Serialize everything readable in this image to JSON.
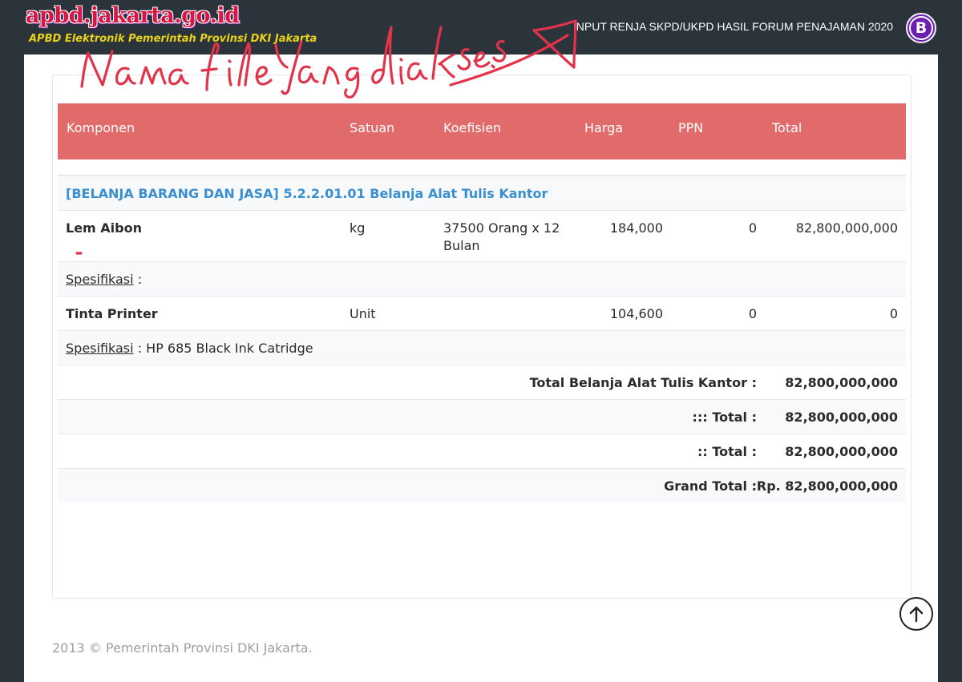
{
  "header": {
    "logo_title": "apbd.jakarta.go.id",
    "logo_subtitle": "APBD Elektronik Pemerintah Provinsi DKI Jakarta",
    "page_title": "INPUT RENJA SKPD/UKPD HASIL FORUM PENAJAMAN 2020",
    "badge_letter": "B"
  },
  "table": {
    "columns": [
      "Komponen",
      "Satuan",
      "Koefisien",
      "Harga",
      "PPN",
      "Total"
    ],
    "group_title": "[BELANJA BARANG DAN JASA] 5.2.2.01.01 Belanja Alat Tulis Kantor",
    "items": [
      {
        "komponen": "Lem Aibon",
        "satuan": "kg",
        "koefisien": "37500 Orang x 12 Bulan",
        "harga": "184,000",
        "ppn": "0",
        "total": "82,800,000,000",
        "spesifikasi_label": "Spesifikasi",
        "spesifikasi_value": ":"
      },
      {
        "komponen": "Tinta Printer",
        "satuan": "Unit",
        "koefisien": "",
        "harga": "104,600",
        "ppn": "0",
        "total": "0",
        "spesifikasi_label": "Spesifikasi",
        "spesifikasi_value": ": HP 685 Black Ink Catridge"
      }
    ],
    "totals": [
      {
        "label": "Total Belanja Alat Tulis Kantor :",
        "value": "82,800,000,000"
      },
      {
        "label": "::: Total :",
        "value": "82,800,000,000"
      },
      {
        "label": ":: Total :",
        "value": "82,800,000,000"
      },
      {
        "label": "Grand Total :",
        "value": "Rp. 82,800,000,000"
      }
    ]
  },
  "footer": {
    "copyright": "2013 © Pemerintah Provinsi DKI Jakarta."
  },
  "annotation": {
    "handwritten_text": "Nama file yang diakses.",
    "color": "#e2334b"
  },
  "colors": {
    "table_header": "#e16b6b",
    "group_title": "#3a8fd0",
    "page_background": "#2b333b"
  },
  "icons": {
    "scroll_top": "arrow-up-circle-icon",
    "brand": "b-badge-icon"
  }
}
